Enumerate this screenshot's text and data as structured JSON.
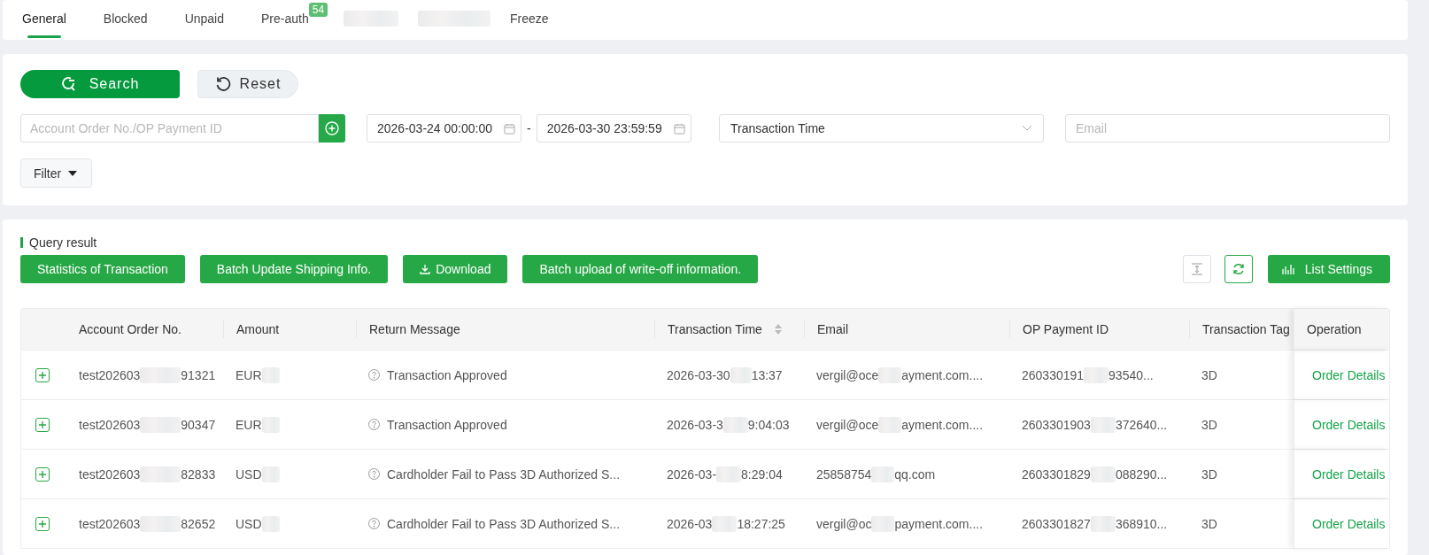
{
  "tabs": [
    {
      "kind": "tab",
      "label": "General",
      "selected": true
    },
    {
      "kind": "tab",
      "label": "Blocked",
      "selected": false
    },
    {
      "kind": "tab",
      "label": "Unpaid",
      "selected": false
    },
    {
      "kind": "tab",
      "label": "Pre-auth",
      "badge": "54",
      "selected": false
    },
    {
      "kind": "redacted"
    },
    {
      "kind": "redacted"
    },
    {
      "kind": "tab",
      "label": "Freeze",
      "selected": false
    }
  ],
  "search": {
    "search_button": "Search",
    "reset_button": "Reset",
    "order_field": {
      "placeholder": "Account Order No./OP Payment ID"
    },
    "date_from": "2026-03-24 00:00:00",
    "date_separator": "-",
    "date_to": "2026-03-30 23:59:59",
    "time_type": "Transaction Time",
    "email_field": {
      "placeholder": "Email"
    },
    "filter_button": "Filter"
  },
  "results": {
    "title": "Query result",
    "actions": [
      {
        "label": "Statistics of Transaction",
        "kind": "plain"
      },
      {
        "label": "Batch Update Shipping Info.",
        "kind": "plain"
      },
      {
        "label": "Download",
        "kind": "download"
      },
      {
        "label": "Batch upload of write-off information.",
        "kind": "plain"
      }
    ],
    "list_settings": "List Settings"
  },
  "table": {
    "columns": [
      {
        "label": "Account Order No.",
        "sortable": false
      },
      {
        "label": "Amount",
        "sortable": false
      },
      {
        "label": "Return Message",
        "sortable": false
      },
      {
        "label": "Transaction Time",
        "sortable": true
      },
      {
        "label": "Email",
        "sortable": false
      },
      {
        "label": "OP Payment ID",
        "sortable": false
      },
      {
        "label": "Transaction Tag",
        "sortable": false
      },
      {
        "label": "Operation",
        "sortable": false
      }
    ],
    "rows": [
      {
        "order": [
          "test202603",
          "91321"
        ],
        "amount": [
          "EUR"
        ],
        "message": "Transaction Approved",
        "time": [
          "2026-03-30",
          "13:37"
        ],
        "email": [
          "vergil@oce",
          "ayment.com...."
        ],
        "payment_id": [
          "260330191",
          "93540..."
        ],
        "tag": "3D",
        "operation": "Order Details"
      },
      {
        "order": [
          "test202603",
          "90347"
        ],
        "amount": [
          "EUR"
        ],
        "message": "Transaction Approved",
        "time": [
          "2026-03-3",
          "9:04:03"
        ],
        "email": [
          "vergil@oce",
          "ayment.com...."
        ],
        "payment_id": [
          "2603301903",
          "372640..."
        ],
        "tag": "3D",
        "operation": "Order Details"
      },
      {
        "order": [
          "test202603",
          "82833"
        ],
        "amount": [
          "USD"
        ],
        "message": "Cardholder Fail to Pass 3D Authorized S...",
        "time": [
          "2026-03-",
          "8:29:04"
        ],
        "email": [
          "25858754",
          "qq.com"
        ],
        "payment_id": [
          "2603301829",
          "088290..."
        ],
        "tag": "3D",
        "operation": "Order Details"
      },
      {
        "order": [
          "test202603",
          "82652"
        ],
        "amount": [
          "USD"
        ],
        "message": "Cardholder Fail to Pass 3D Authorized S...",
        "time": [
          "2026-03",
          "18:27:25"
        ],
        "email": [
          "vergil@oc",
          "payment.com...."
        ],
        "payment_id": [
          "2603301827",
          "368910..."
        ],
        "tag": "3D",
        "operation": "Order Details"
      }
    ]
  }
}
